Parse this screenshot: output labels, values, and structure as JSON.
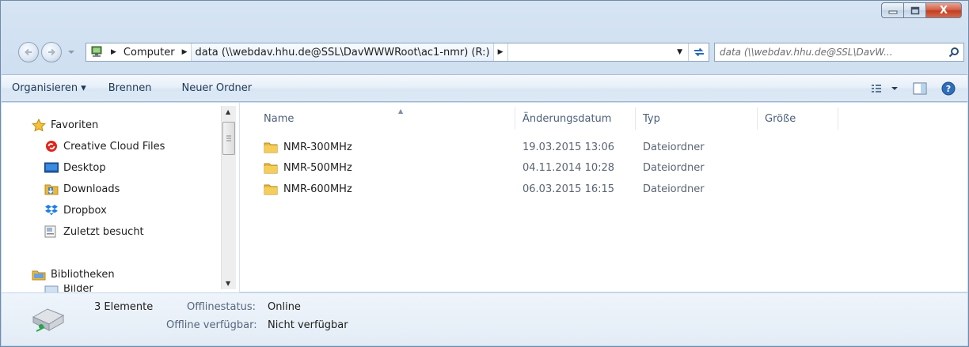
{
  "window": {
    "caption_buttons": {
      "minimize": "–",
      "maximize": "□",
      "close": "X"
    }
  },
  "nav": {
    "breadcrumb": [
      "Computer",
      "data (\\\\webdav.hhu.de@SSL\\DavWWWRoot\\ac1-nmr) (R:)"
    ],
    "search_placeholder": "data (\\\\webdav.hhu.de@SSL\\DavW..."
  },
  "commands": {
    "organize": "Organisieren ▾",
    "burn": "Brennen",
    "new_folder": "Neuer Ordner"
  },
  "sidebar": {
    "favorites_header": "Favoriten",
    "favorites": [
      {
        "label": "Creative Cloud Files",
        "icon": "creative-cloud-icon"
      },
      {
        "label": "Desktop",
        "icon": "desktop-icon"
      },
      {
        "label": "Downloads",
        "icon": "downloads-icon"
      },
      {
        "label": "Dropbox",
        "icon": "dropbox-icon"
      },
      {
        "label": "Zuletzt besucht",
        "icon": "recent-places-icon"
      }
    ],
    "libraries_header": "Bibliotheken",
    "libraries_partial": "Bilder"
  },
  "columns": {
    "name": "Name",
    "modified": "Änderungsdatum",
    "type": "Typ",
    "size": "Größe"
  },
  "files": [
    {
      "name": "NMR-300MHz",
      "modified": "19.03.2015 13:06",
      "type": "Dateiordner",
      "size": ""
    },
    {
      "name": "NMR-500MHz",
      "modified": "04.11.2014 10:28",
      "type": "Dateiordner",
      "size": ""
    },
    {
      "name": "NMR-600MHz",
      "modified": "06.03.2015 16:15",
      "type": "Dateiordner",
      "size": ""
    }
  ],
  "details": {
    "count": "3 Elemente",
    "offline_status_label": "Offlinestatus:",
    "offline_status_value": "Online",
    "offline_available_label": "Offline verfügbar:",
    "offline_available_value": "Nicht verfügbar"
  },
  "colors": {
    "accent": "#3a6ea5",
    "folder": "#e8b93c",
    "window_frame": "#c8dbef"
  }
}
